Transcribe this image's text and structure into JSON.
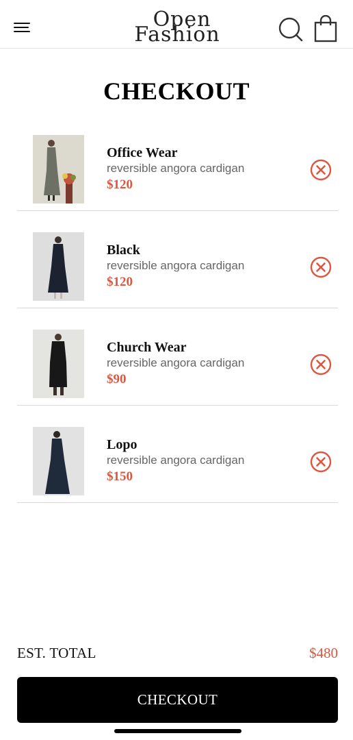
{
  "header": {
    "logo_line1": "Open",
    "logo_line2": "Fashion",
    "menu_icon": "hamburger-menu-icon",
    "search_icon": "search-icon",
    "bag_icon": "shopping-bag-icon"
  },
  "page": {
    "title": "CHECKOUT"
  },
  "cart": {
    "items": [
      {
        "name": "Office Wear",
        "description": "reversible angora cardigan",
        "price": "$120",
        "image": "model-in-grey-office-dress"
      },
      {
        "name": "Black",
        "description": "reversible angora cardigan",
        "price": "$120",
        "image": "model-in-black-coat-dress"
      },
      {
        "name": "Church Wear",
        "description": "reversible angora cardigan",
        "price": "$90",
        "image": "model-in-black-long-sleeve-dress"
      },
      {
        "name": "Lopo",
        "description": "reversible angora cardigan",
        "price": "$150",
        "image": "model-in-navy-coat-dress"
      }
    ],
    "remove_icon": "close-circle-icon"
  },
  "summary": {
    "total_label": "EST. TOTAL",
    "total_value": "$480"
  },
  "checkout_button": {
    "label": "CHECKOUT"
  },
  "colors": {
    "accent": "#dd5740",
    "button_bg": "#000000",
    "divider": "#d8d8d8"
  }
}
